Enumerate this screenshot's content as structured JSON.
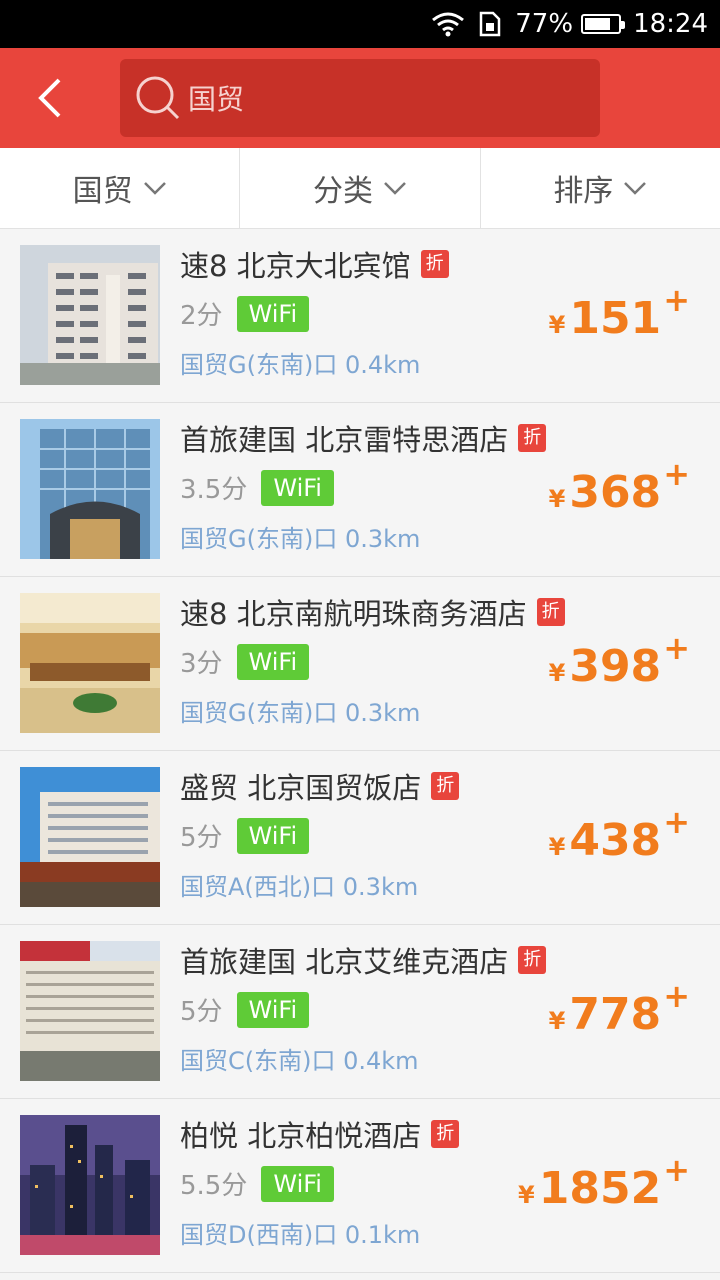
{
  "status_bar": {
    "battery": "77%",
    "time": "18:24",
    "battery_level": 0.77
  },
  "search": {
    "query": "国贸"
  },
  "filters": [
    {
      "label": "国贸"
    },
    {
      "label": "分类"
    },
    {
      "label": "排序"
    }
  ],
  "badge_discount": "折",
  "currency": "¥",
  "price_suffix": "+",
  "hotels": [
    {
      "name": "速8 北京大北宾馆",
      "score": "2分",
      "wifi": "WiFi",
      "location": "国贸G(东南)口 0.4km",
      "price": "151",
      "thumb": "building-white"
    },
    {
      "name": "首旅建国 北京雷特思酒店",
      "score": "3.5分",
      "wifi": "WiFi",
      "location": "国贸G(东南)口 0.3km",
      "price": "368",
      "thumb": "building-glass"
    },
    {
      "name": "速8 北京南航明珠商务酒店",
      "score": "3分",
      "wifi": "WiFi",
      "location": "国贸G(东南)口 0.3km",
      "price": "398",
      "thumb": "lobby"
    },
    {
      "name": "盛贸 北京国贸饭店",
      "score": "5分",
      "wifi": "WiFi",
      "location": "国贸A(西北)口 0.3km",
      "price": "438",
      "thumb": "building-sky"
    },
    {
      "name": "首旅建国 北京艾维克酒店",
      "score": "5分",
      "wifi": "WiFi",
      "location": "国贸C(东南)口 0.4km",
      "price": "778",
      "thumb": "building-grid"
    },
    {
      "name": "柏悦 北京柏悦酒店",
      "score": "5.5分",
      "wifi": "WiFi",
      "location": "国贸D(西南)口 0.1km",
      "price": "1852",
      "thumb": "night-city"
    }
  ]
}
